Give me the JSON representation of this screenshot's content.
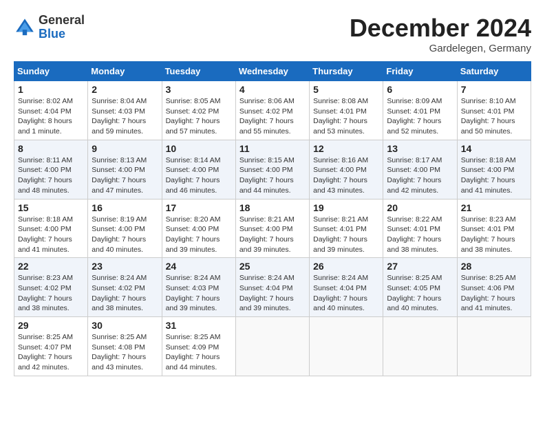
{
  "logo": {
    "general": "General",
    "blue": "Blue"
  },
  "title": "December 2024",
  "subtitle": "Gardelegen, Germany",
  "days_header": [
    "Sunday",
    "Monday",
    "Tuesday",
    "Wednesday",
    "Thursday",
    "Friday",
    "Saturday"
  ],
  "weeks": [
    [
      {
        "day": "1",
        "sunrise": "8:02 AM",
        "sunset": "4:04 PM",
        "daylight": "8 hours and 1 minute."
      },
      {
        "day": "2",
        "sunrise": "8:04 AM",
        "sunset": "4:03 PM",
        "daylight": "7 hours and 59 minutes."
      },
      {
        "day": "3",
        "sunrise": "8:05 AM",
        "sunset": "4:02 PM",
        "daylight": "7 hours and 57 minutes."
      },
      {
        "day": "4",
        "sunrise": "8:06 AM",
        "sunset": "4:02 PM",
        "daylight": "7 hours and 55 minutes."
      },
      {
        "day": "5",
        "sunrise": "8:08 AM",
        "sunset": "4:01 PM",
        "daylight": "7 hours and 53 minutes."
      },
      {
        "day": "6",
        "sunrise": "8:09 AM",
        "sunset": "4:01 PM",
        "daylight": "7 hours and 52 minutes."
      },
      {
        "day": "7",
        "sunrise": "8:10 AM",
        "sunset": "4:01 PM",
        "daylight": "7 hours and 50 minutes."
      }
    ],
    [
      {
        "day": "8",
        "sunrise": "8:11 AM",
        "sunset": "4:00 PM",
        "daylight": "7 hours and 48 minutes."
      },
      {
        "day": "9",
        "sunrise": "8:13 AM",
        "sunset": "4:00 PM",
        "daylight": "7 hours and 47 minutes."
      },
      {
        "day": "10",
        "sunrise": "8:14 AM",
        "sunset": "4:00 PM",
        "daylight": "7 hours and 46 minutes."
      },
      {
        "day": "11",
        "sunrise": "8:15 AM",
        "sunset": "4:00 PM",
        "daylight": "7 hours and 44 minutes."
      },
      {
        "day": "12",
        "sunrise": "8:16 AM",
        "sunset": "4:00 PM",
        "daylight": "7 hours and 43 minutes."
      },
      {
        "day": "13",
        "sunrise": "8:17 AM",
        "sunset": "4:00 PM",
        "daylight": "7 hours and 42 minutes."
      },
      {
        "day": "14",
        "sunrise": "8:18 AM",
        "sunset": "4:00 PM",
        "daylight": "7 hours and 41 minutes."
      }
    ],
    [
      {
        "day": "15",
        "sunrise": "8:18 AM",
        "sunset": "4:00 PM",
        "daylight": "7 hours and 41 minutes."
      },
      {
        "day": "16",
        "sunrise": "8:19 AM",
        "sunset": "4:00 PM",
        "daylight": "7 hours and 40 minutes."
      },
      {
        "day": "17",
        "sunrise": "8:20 AM",
        "sunset": "4:00 PM",
        "daylight": "7 hours and 39 minutes."
      },
      {
        "day": "18",
        "sunrise": "8:21 AM",
        "sunset": "4:00 PM",
        "daylight": "7 hours and 39 minutes."
      },
      {
        "day": "19",
        "sunrise": "8:21 AM",
        "sunset": "4:01 PM",
        "daylight": "7 hours and 39 minutes."
      },
      {
        "day": "20",
        "sunrise": "8:22 AM",
        "sunset": "4:01 PM",
        "daylight": "7 hours and 38 minutes."
      },
      {
        "day": "21",
        "sunrise": "8:23 AM",
        "sunset": "4:01 PM",
        "daylight": "7 hours and 38 minutes."
      }
    ],
    [
      {
        "day": "22",
        "sunrise": "8:23 AM",
        "sunset": "4:02 PM",
        "daylight": "7 hours and 38 minutes."
      },
      {
        "day": "23",
        "sunrise": "8:24 AM",
        "sunset": "4:02 PM",
        "daylight": "7 hours and 38 minutes."
      },
      {
        "day": "24",
        "sunrise": "8:24 AM",
        "sunset": "4:03 PM",
        "daylight": "7 hours and 39 minutes."
      },
      {
        "day": "25",
        "sunrise": "8:24 AM",
        "sunset": "4:04 PM",
        "daylight": "7 hours and 39 minutes."
      },
      {
        "day": "26",
        "sunrise": "8:24 AM",
        "sunset": "4:04 PM",
        "daylight": "7 hours and 40 minutes."
      },
      {
        "day": "27",
        "sunrise": "8:25 AM",
        "sunset": "4:05 PM",
        "daylight": "7 hours and 40 minutes."
      },
      {
        "day": "28",
        "sunrise": "8:25 AM",
        "sunset": "4:06 PM",
        "daylight": "7 hours and 41 minutes."
      }
    ],
    [
      {
        "day": "29",
        "sunrise": "8:25 AM",
        "sunset": "4:07 PM",
        "daylight": "7 hours and 42 minutes."
      },
      {
        "day": "30",
        "sunrise": "8:25 AM",
        "sunset": "4:08 PM",
        "daylight": "7 hours and 43 minutes."
      },
      {
        "day": "31",
        "sunrise": "8:25 AM",
        "sunset": "4:09 PM",
        "daylight": "7 hours and 44 minutes."
      },
      null,
      null,
      null,
      null
    ]
  ]
}
